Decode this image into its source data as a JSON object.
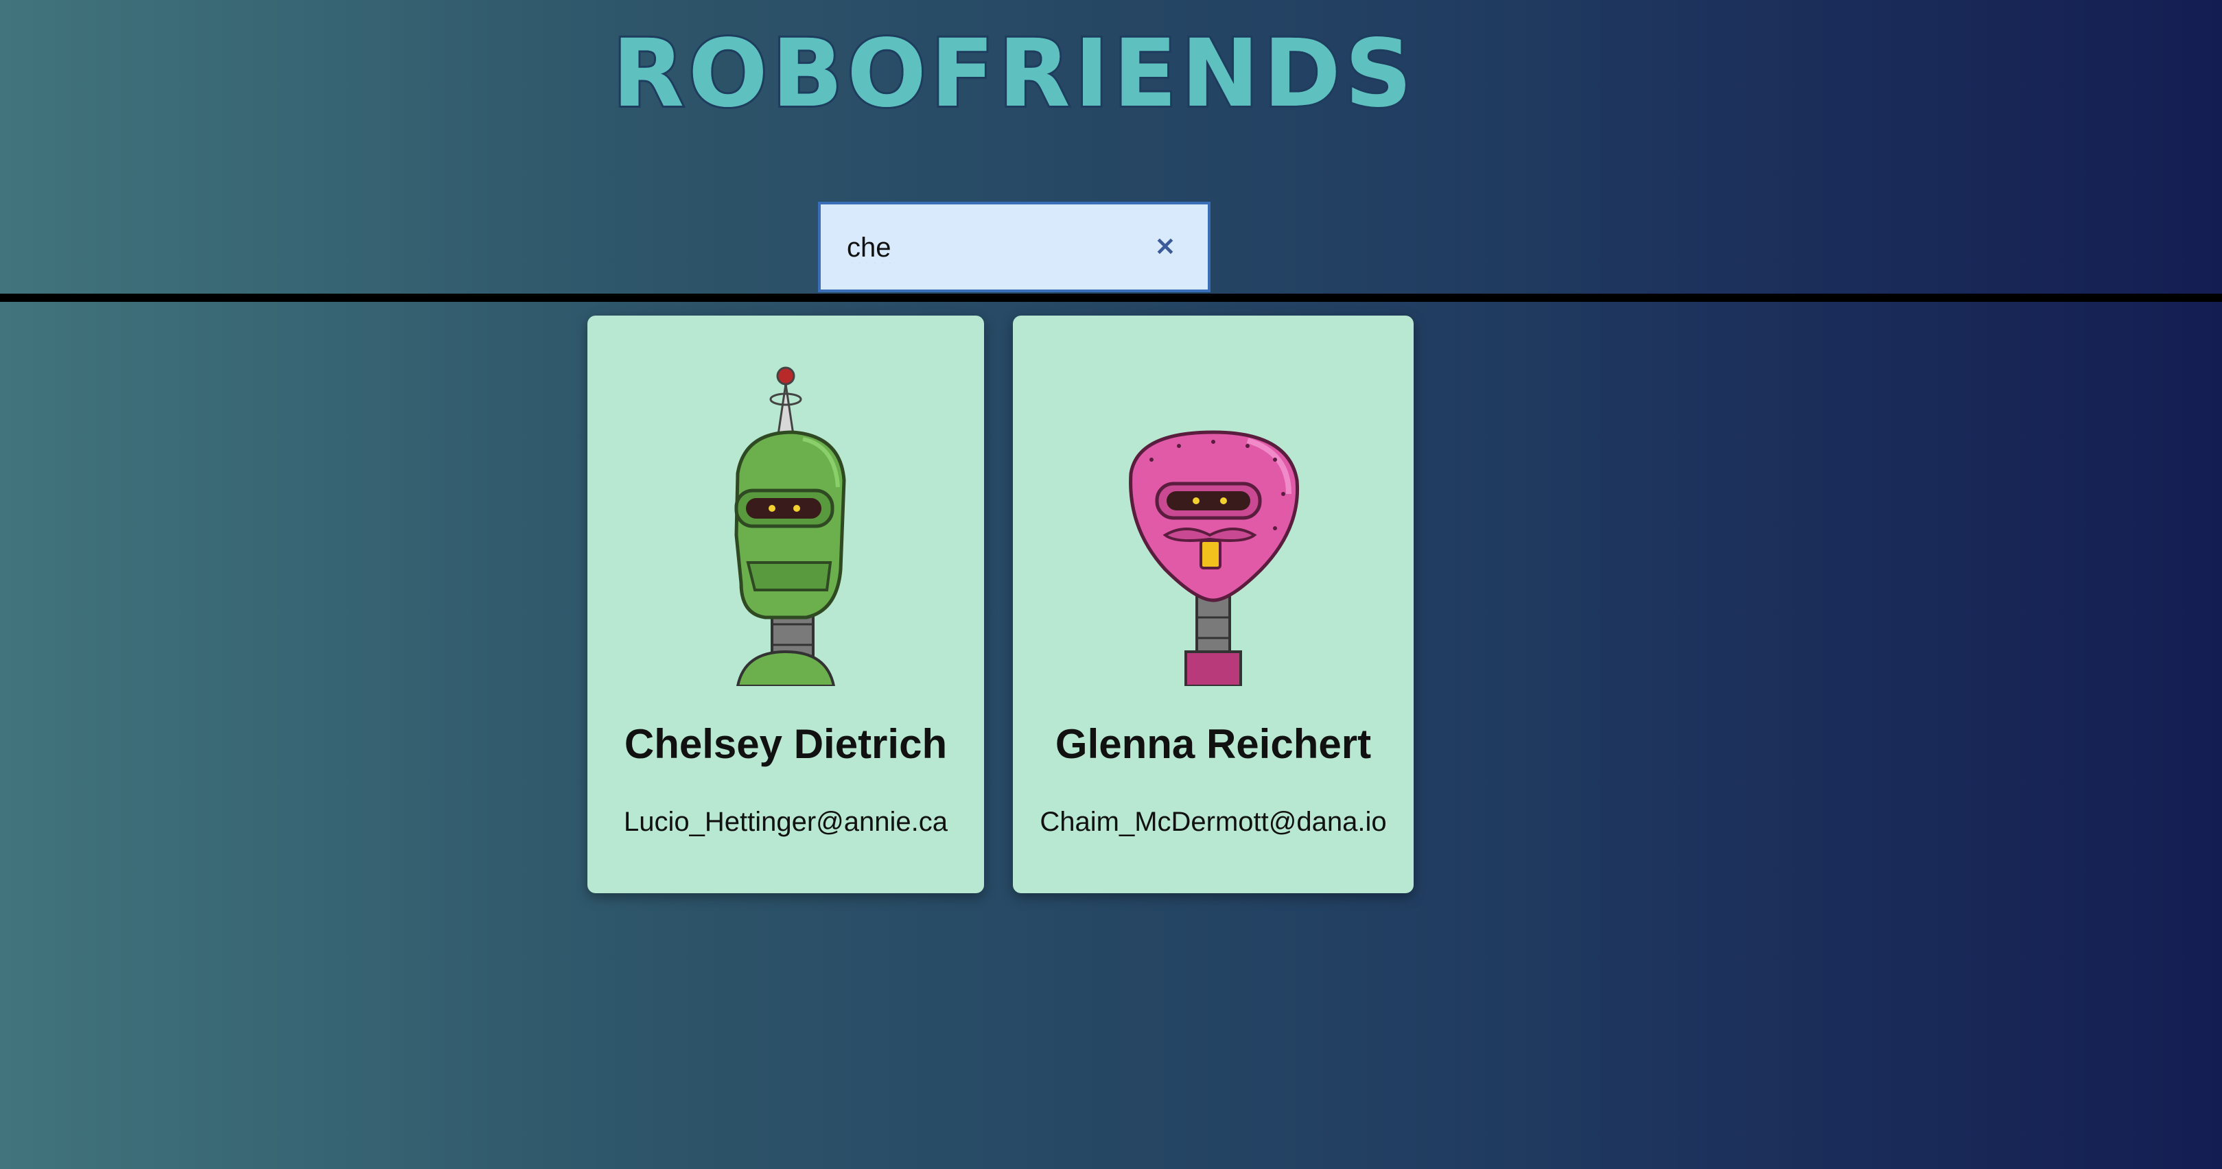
{
  "app": {
    "title": "ROBOFRIENDS"
  },
  "search": {
    "value": "che",
    "clear_icon": "close-icon"
  },
  "robots": [
    {
      "name": "Chelsey Dietrich",
      "email": "Lucio_Hettinger@annie.ca",
      "color": "#6bb04d"
    },
    {
      "name": "Glenna Reichert",
      "email": "Chaim_McDermott@dana.io",
      "color": "#e05aa8"
    }
  ],
  "colors": {
    "title": "#5fc0c0",
    "card_background": "#b8e8d1",
    "search_background": "#d8eafc",
    "search_border": "#3a6fb8"
  }
}
